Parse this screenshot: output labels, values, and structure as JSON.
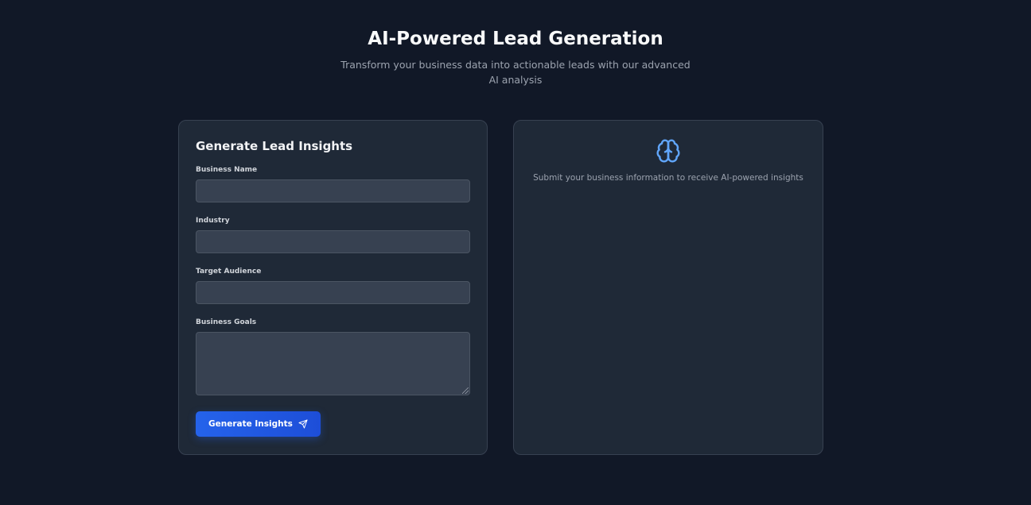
{
  "header": {
    "title": "AI-Powered Lead Generation",
    "subtitle": "Transform your business data into actionable leads with our advanced AI analysis"
  },
  "form": {
    "title": "Generate Lead Insights",
    "fields": [
      {
        "label": "Business Name",
        "value": "",
        "placeholder": ""
      },
      {
        "label": "Industry",
        "value": "",
        "placeholder": ""
      },
      {
        "label": "Target Audience",
        "value": "",
        "placeholder": ""
      },
      {
        "label": "Business Goals",
        "value": "",
        "placeholder": ""
      }
    ],
    "submit_label": "Generate Insights",
    "submit_icon": "send-icon"
  },
  "result": {
    "icon": "brain-icon",
    "message": "Submit your business information to receive AI-powered insights"
  },
  "colors": {
    "background": "#111827",
    "card": "#1f2937",
    "input": "#374151",
    "accent": "#2563eb",
    "icon": "#60a5fa"
  }
}
